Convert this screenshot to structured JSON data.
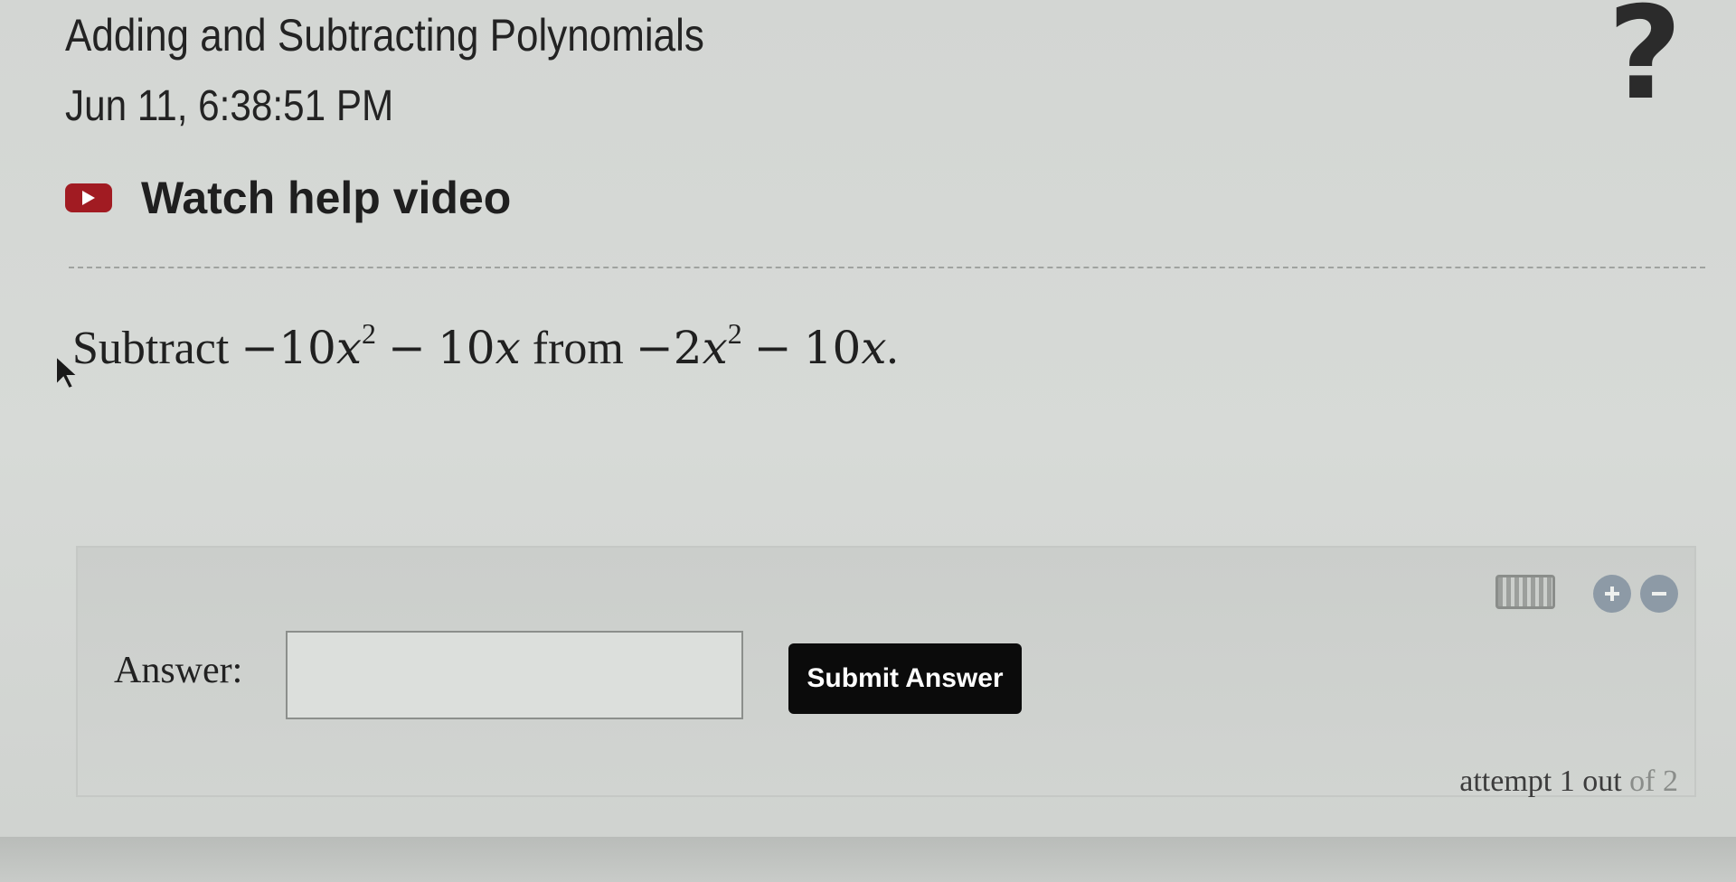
{
  "header": {
    "title": "Adding and Subtracting Polynomials",
    "timestamp": "Jun 11, 6:38:51 PM",
    "help_icon_symbol": "?"
  },
  "help_video": {
    "label": "Watch help video",
    "icon": "play-video-icon",
    "icon_color": "#a11b22"
  },
  "question": {
    "verb": "Subtract",
    "first_expression": {
      "minus": "−",
      "coefficient_1": "10",
      "variable": "x",
      "exponent": "2",
      "operator": "−",
      "coefficient_2": "10"
    },
    "connector": "from",
    "second_expression": {
      "minus": "−",
      "coefficient_1": "2",
      "variable": "x",
      "exponent": "2",
      "operator": "−",
      "coefficient_2": "10"
    },
    "period": "."
  },
  "answer_area": {
    "label": "Answer:",
    "input_value": "",
    "submit_label": "Submit Answer",
    "tools": [
      "keyboard-icon",
      "zoom-in-icon",
      "zoom-out-icon"
    ],
    "attempt": {
      "prefix": "attempt 1 out",
      "suffix": "of 2"
    }
  },
  "colors": {
    "background": "#d6d9d6",
    "submit_background": "#0b0b0b",
    "submit_text": "#ffffff",
    "zoom_buttons": "#8d9aa6"
  }
}
